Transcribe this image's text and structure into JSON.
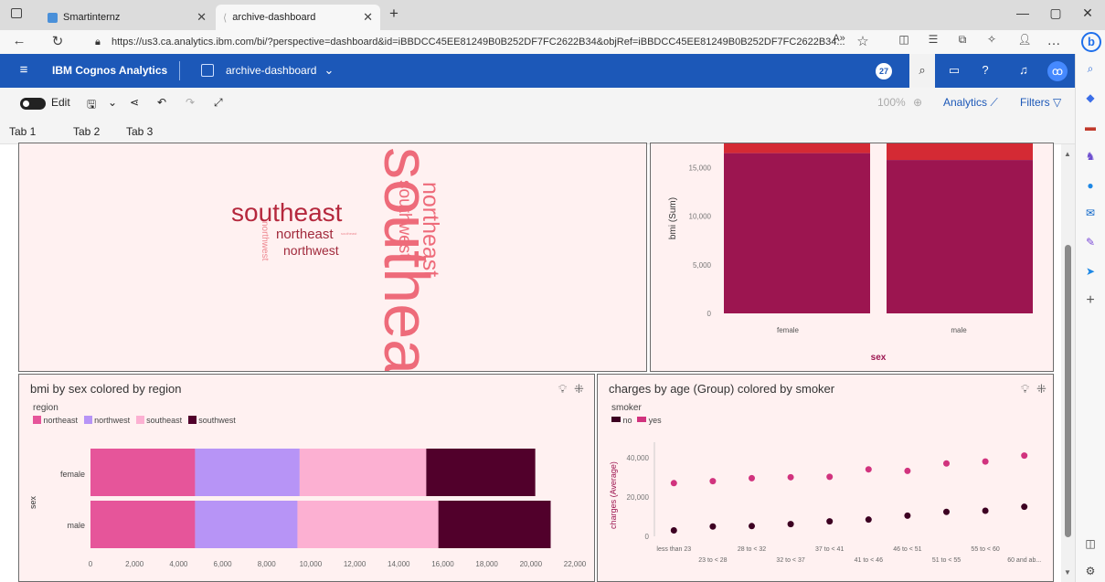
{
  "browser": {
    "tabs": [
      {
        "title": "Smartinternz",
        "active": false
      },
      {
        "title": "archive-dashboard",
        "active": true
      }
    ],
    "url": "https://us3.ca.analytics.ibm.com/bi/?perspective=dashboard&id=iBBDCC45EE81249B0B252DF7FC2622B34&objRef=iBBDCC45EE81249B0B252DF7FC2622B34..."
  },
  "app": {
    "brand": "IBM Cognos Analytics",
    "dashboard_name": "archive-dashboard",
    "notification_count": "27"
  },
  "toolbar": {
    "edit_label": "Edit",
    "zoom": "100%",
    "analytics_label": "Analytics",
    "filters_label": "Filters"
  },
  "dash_tabs": [
    "Tab 1",
    "Tab 2",
    "Tab 3"
  ],
  "active_dash_tab": 1,
  "wordcloud": {
    "words": [
      "southeast",
      "southeast",
      "northeast",
      "northeast",
      "southwest",
      "northwest",
      "northwest",
      "southeast",
      "southwest"
    ]
  },
  "bar_top": {
    "ylabel": "bmi (Sum)",
    "xlabel": "sex",
    "y_ticks": [
      "15,000",
      "10,000",
      "5,000",
      "0"
    ],
    "categories": [
      "female",
      "male"
    ]
  },
  "bmi_panel": {
    "title": "bmi by sex colored by region",
    "legend_title": "region",
    "ylabel": "sex"
  },
  "charges_panel": {
    "title": "charges by age (Group) colored by smoker",
    "legend_title": "smoker",
    "ylabel": "charges (Average)"
  },
  "colors": {
    "header": "#1c58b8",
    "panel_bg": "#fff1f1",
    "crimson": "#9c1550",
    "red": "#d42a34",
    "northeast": "#e6559a",
    "northwest": "#b794f6",
    "southeast": "#fcb0d2",
    "southwest": "#51002b",
    "smoker_no": "#3d0022",
    "smoker_yes": "#d1337e"
  },
  "chart_data": [
    {
      "type": "bar",
      "stacked": true,
      "categories": [
        "female",
        "male"
      ],
      "series": [
        {
          "values": [
            16500,
            15800
          ]
        },
        {
          "values": [
            17500,
            17500
          ]
        }
      ],
      "ylim": [
        0,
        17500
      ],
      "xlabel": "sex",
      "ylabel": "bmi (Sum)",
      "y_ticks": [
        "15,000",
        "10,000",
        "5,000",
        "0"
      ]
    },
    {
      "type": "bar",
      "orientation": "horizontal",
      "stacked": true,
      "title": "bmi by sex colored by region",
      "categories": [
        "female",
        "male"
      ],
      "series": [
        {
          "name": "northeast",
          "values": [
            4750,
            4750
          ]
        },
        {
          "name": "northwest",
          "values": [
            4750,
            4650
          ]
        },
        {
          "name": "southeast",
          "values": [
            5750,
            6400
          ]
        },
        {
          "name": "southwest",
          "values": [
            4950,
            5100
          ]
        }
      ],
      "xlim": [
        0,
        22000
      ],
      "x_ticks": [
        "0",
        "2,000",
        "4,000",
        "6,000",
        "8,000",
        "10,000",
        "12,000",
        "14,000",
        "16,000",
        "18,000",
        "20,000",
        "22,000"
      ],
      "ylabel": "sex",
      "legend_title": "region"
    },
    {
      "type": "scatter",
      "title": "charges by age (Group) colored by smoker",
      "categories": [
        "less than 23",
        "23 to < 28",
        "28 to < 32",
        "32 to < 37",
        "37 to < 41",
        "41 to < 46",
        "46 to < 51",
        "51 to < 55",
        "55 to < 60",
        "60 and ab..."
      ],
      "series": [
        {
          "name": "no",
          "values": [
            3000,
            5000,
            5200,
            6200,
            7600,
            8500,
            10500,
            12400,
            13000,
            15000
          ]
        },
        {
          "name": "yes",
          "values": [
            27000,
            28000,
            29500,
            30000,
            30200,
            34000,
            33200,
            37000,
            38000,
            41000
          ]
        }
      ],
      "ylim": [
        0,
        45000
      ],
      "y_ticks": [
        "40,000",
        "20,000",
        "0"
      ],
      "ylabel": "charges (Average)",
      "legend_title": "smoker"
    }
  ]
}
